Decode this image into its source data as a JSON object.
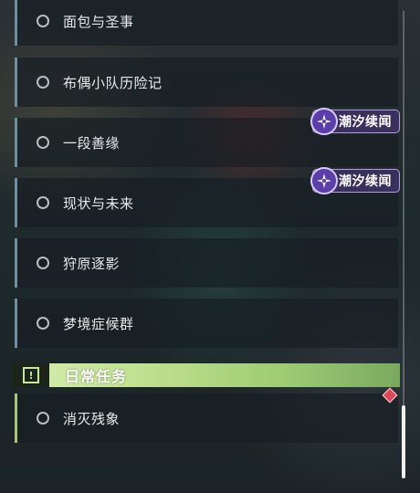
{
  "quests": [
    {
      "label": "面包与圣事"
    },
    {
      "label": "布偶小队历险记"
    },
    {
      "label": "一段善缘"
    },
    {
      "label": "现状与未来"
    },
    {
      "label": "狩原逐影"
    },
    {
      "label": "梦境症候群"
    }
  ],
  "badges": [
    {
      "label": "潮汐续闻",
      "icon": "sparkle-icon"
    },
    {
      "label": "潮汐续闻",
      "icon": "sparkle-icon"
    }
  ],
  "daily_section": {
    "title": "日常任务",
    "icon": "exclamation-icon",
    "quests": [
      {
        "label": "消灭残象"
      }
    ]
  },
  "colors": {
    "main_quest_accent": "#6f8ea0",
    "daily_accent": "#a9c57a",
    "badge_bg": "#3c325f",
    "badge_border": "#b49ce6",
    "alert_diamond": "#e0475a"
  }
}
